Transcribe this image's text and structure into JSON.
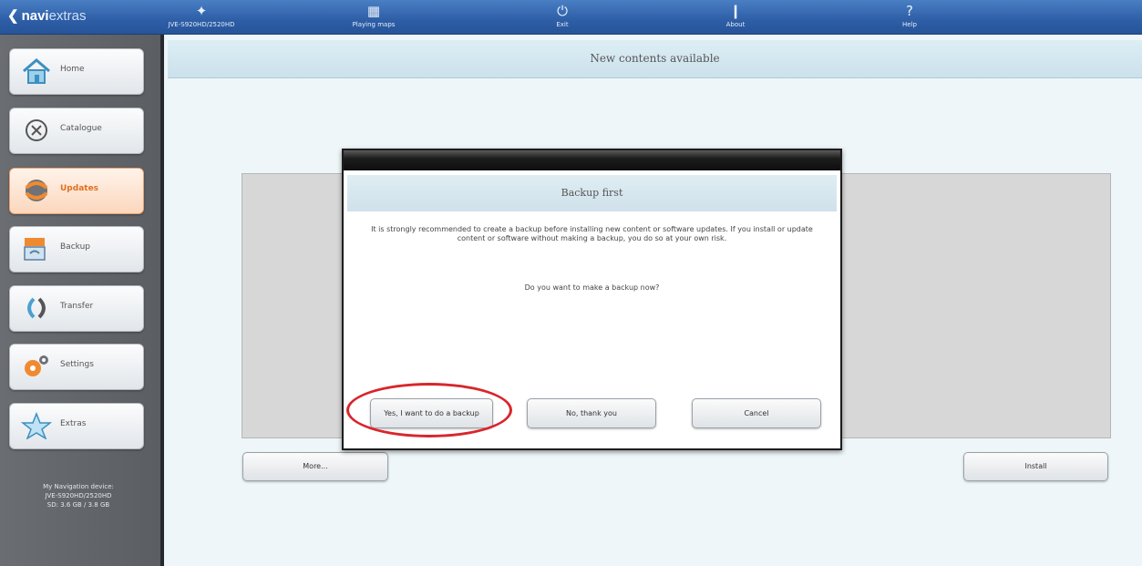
{
  "topbar": {
    "logo_prefix": "navi",
    "logo_suffix": "extras",
    "items": [
      {
        "icon": "device-icon",
        "label": "JVE-S920HD/2520HD"
      },
      {
        "icon": "map-icon",
        "label": "Playing maps"
      },
      {
        "icon": "exit-icon",
        "label": "Exit"
      },
      {
        "icon": "info-icon",
        "label": "About"
      },
      {
        "icon": "help-icon",
        "label": "Help"
      }
    ]
  },
  "sidebar": {
    "items": [
      {
        "label": "Home",
        "icon": "home-icon"
      },
      {
        "label": "Catalogue",
        "icon": "catalogue-icon"
      },
      {
        "label": "Updates",
        "icon": "updates-icon",
        "active": true
      },
      {
        "label": "Backup",
        "icon": "backup-icon"
      },
      {
        "label": "Transfer",
        "icon": "transfer-icon"
      },
      {
        "label": "Settings",
        "icon": "settings-icon"
      },
      {
        "label": "Extras",
        "icon": "star-icon"
      }
    ],
    "device_info": {
      "line1": "My Navigation device:",
      "line2": "JVE-S920HD/2520HD",
      "line3": "SD: 3.6 GB / 3.8 GB"
    }
  },
  "main": {
    "header": "New contents available",
    "more_button": "More...",
    "install_button": "Install"
  },
  "dialog": {
    "title": "Backup first",
    "message": "It is strongly recommended to create a backup before installing new content or software updates. If you install or update content or software without making a backup, you do so at your own risk.",
    "question": "Do you want to make a backup now?",
    "buttons": {
      "yes": "Yes, I want to do a backup",
      "no": "No, thank you",
      "cancel": "Cancel"
    }
  },
  "colors": {
    "topbar": "#2d5ea6",
    "sidebar": "#616469",
    "active_nav": "#fbd7bd",
    "highlight": "#d8262c"
  }
}
